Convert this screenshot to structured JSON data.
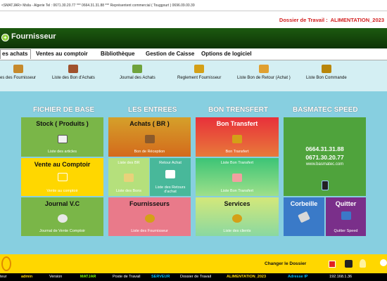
{
  "titlebar": {
    "text": "<SMATJAR> Msila - Algerie Tel : 0671.30.20.77 *** 0664.31.31.88 *** Représentent commercial ( Touggourt ) 0696.09.00.39"
  },
  "header": {
    "dossier_label": "Dossier de Travail :",
    "dossier_value": "ALIMENTATION_2023"
  },
  "banner": {
    "title": "Fournisseur",
    "logo_glyph": "+"
  },
  "menu": [
    {
      "label": "es achats",
      "active": true
    },
    {
      "label": "Ventes  au comptoir"
    },
    {
      "label": "Bibliothèque"
    },
    {
      "label": "Gestion de Caisse"
    },
    {
      "label": "Options de logiciel"
    }
  ],
  "toolbar": [
    {
      "label": "es des Fournisseur",
      "icon": "suppliers-icon",
      "color": "#c68a2c"
    },
    {
      "label": "Liste des Bon d'Achats",
      "icon": "purchase-orders-icon",
      "color": "#a0522d"
    },
    {
      "label": "Journal des Achats",
      "icon": "purchase-journal-icon",
      "color": "#6fa33c"
    },
    {
      "label": "Reglement Fournisseur",
      "icon": "supplier-payment-icon",
      "color": "#d4a017"
    },
    {
      "label": "Liste Bon de Retour (Achat )",
      "icon": "return-orders-icon",
      "color": "#e0a030"
    },
    {
      "label": "Liste Bon Commande",
      "icon": "order-list-icon",
      "color": "#b8860b"
    }
  ],
  "columns": [
    "FICHIER DE BASE",
    "LES ENTREES",
    "BON TRENSFERT",
    "BASMATEC SPEED"
  ],
  "tiles": {
    "stock": {
      "title": "Stock ( Produits )",
      "sub": "Liste des articles"
    },
    "vente": {
      "title": "Vente au Comptoir",
      "sub": "Vente au comptoir"
    },
    "journal": {
      "title": "Journal V.C",
      "sub": "Journal de Vente Comptoir"
    },
    "achats": {
      "title": "Achats ( BR )",
      "sub": "Bon de Réception"
    },
    "listebr": {
      "title": "Liste des BR",
      "sub": "Liste des Bons"
    },
    "retour": {
      "title": "Retour Achat",
      "sub": "Liste des Retours d'achat"
    },
    "fournisseurs": {
      "title": "Fournisseurs",
      "sub": "Liste des Fournisseur"
    },
    "bontrans": {
      "title": "Bon Transfert",
      "sub": "Bon Transfert"
    },
    "listetrans": {
      "title": "Liste Bon Transfert",
      "sub": "Liste Bon Transfert"
    },
    "services": {
      "title": "Services",
      "sub": "Liste des clients"
    },
    "speed": {
      "phone1": "0664.31.31.88",
      "phone2": "0671.30.20.77",
      "site": "www.basmatec.com"
    },
    "corbeille": {
      "title": "Corbeille"
    },
    "quitter": {
      "title": "Quitter",
      "sub": "Quitter Speed"
    }
  },
  "footer": {
    "changer": "Changer le Dossier"
  },
  "status": [
    {
      "text": "teur",
      "color": "#ffffff"
    },
    {
      "text": "admin",
      "color": "#ffd700"
    },
    {
      "text": "Version",
      "color": "#ffffff"
    },
    {
      "text": "MATJAR",
      "color": "#7fff00"
    },
    {
      "text": "Poste de Travail",
      "color": "#ffffff"
    },
    {
      "text": "SERVEUR",
      "color": "#00bfff"
    },
    {
      "text": "Dossier de Travail",
      "color": "#ffffff"
    },
    {
      "text": "ALIMENTATION_2023",
      "color": "#ffd700"
    },
    {
      "text": "Adresse IP",
      "color": "#00bfff"
    },
    {
      "text": "192.168.1.36",
      "color": "#ffffff"
    }
  ]
}
